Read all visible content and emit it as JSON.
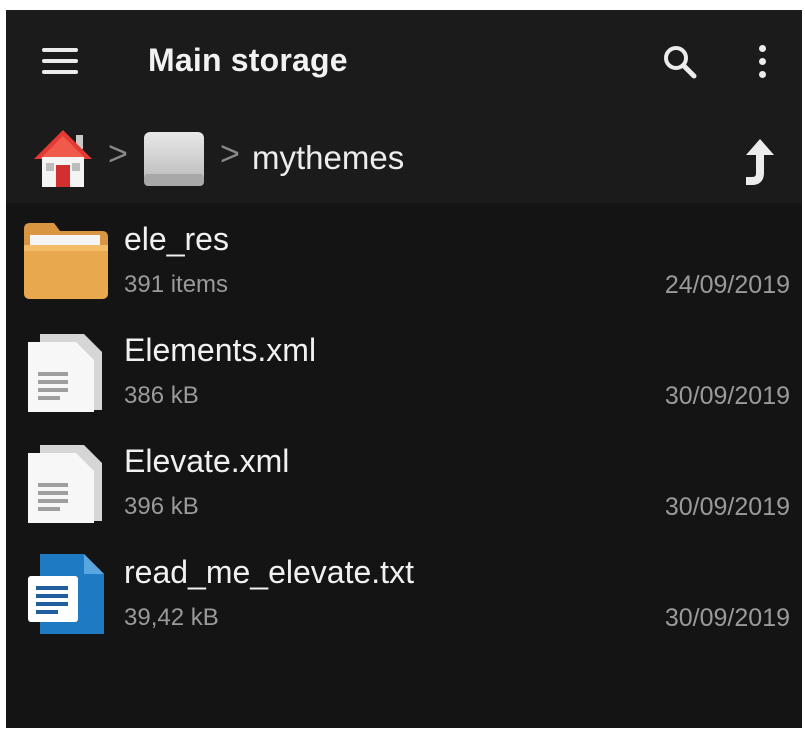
{
  "appbar": {
    "title": "Main storage",
    "icons": [
      "menu-icon",
      "search-icon",
      "more-vert-icon"
    ]
  },
  "pathbar": {
    "crumbs": [
      {
        "icon": "home-icon"
      },
      {
        "icon": "drive-icon"
      },
      {
        "label": "mythemes"
      }
    ],
    "separator": ">",
    "up_icon": "arrow-up-icon"
  },
  "files": [
    {
      "name": "ele_res",
      "meta": "391 items",
      "date": "24/09/2019",
      "icon": "folder-icon"
    },
    {
      "name": "Elements.xml",
      "meta": "386 kB",
      "date": "30/09/2019",
      "icon": "document-icon"
    },
    {
      "name": "Elevate.xml",
      "meta": "396 kB",
      "date": "30/09/2019",
      "icon": "document-icon"
    },
    {
      "name": "read_me_elevate.txt",
      "meta": "39,42 kB",
      "date": "30/09/2019",
      "icon": "text-file-icon"
    }
  ],
  "colors": {
    "background": "#141414",
    "toolbar": "#1b1b1b",
    "primary_text": "#f1f1f1",
    "secondary_text": "#9a9a9a",
    "folder": "#e8a94e",
    "text_file": "#1f7ac4",
    "home_roof": "#e53935"
  }
}
